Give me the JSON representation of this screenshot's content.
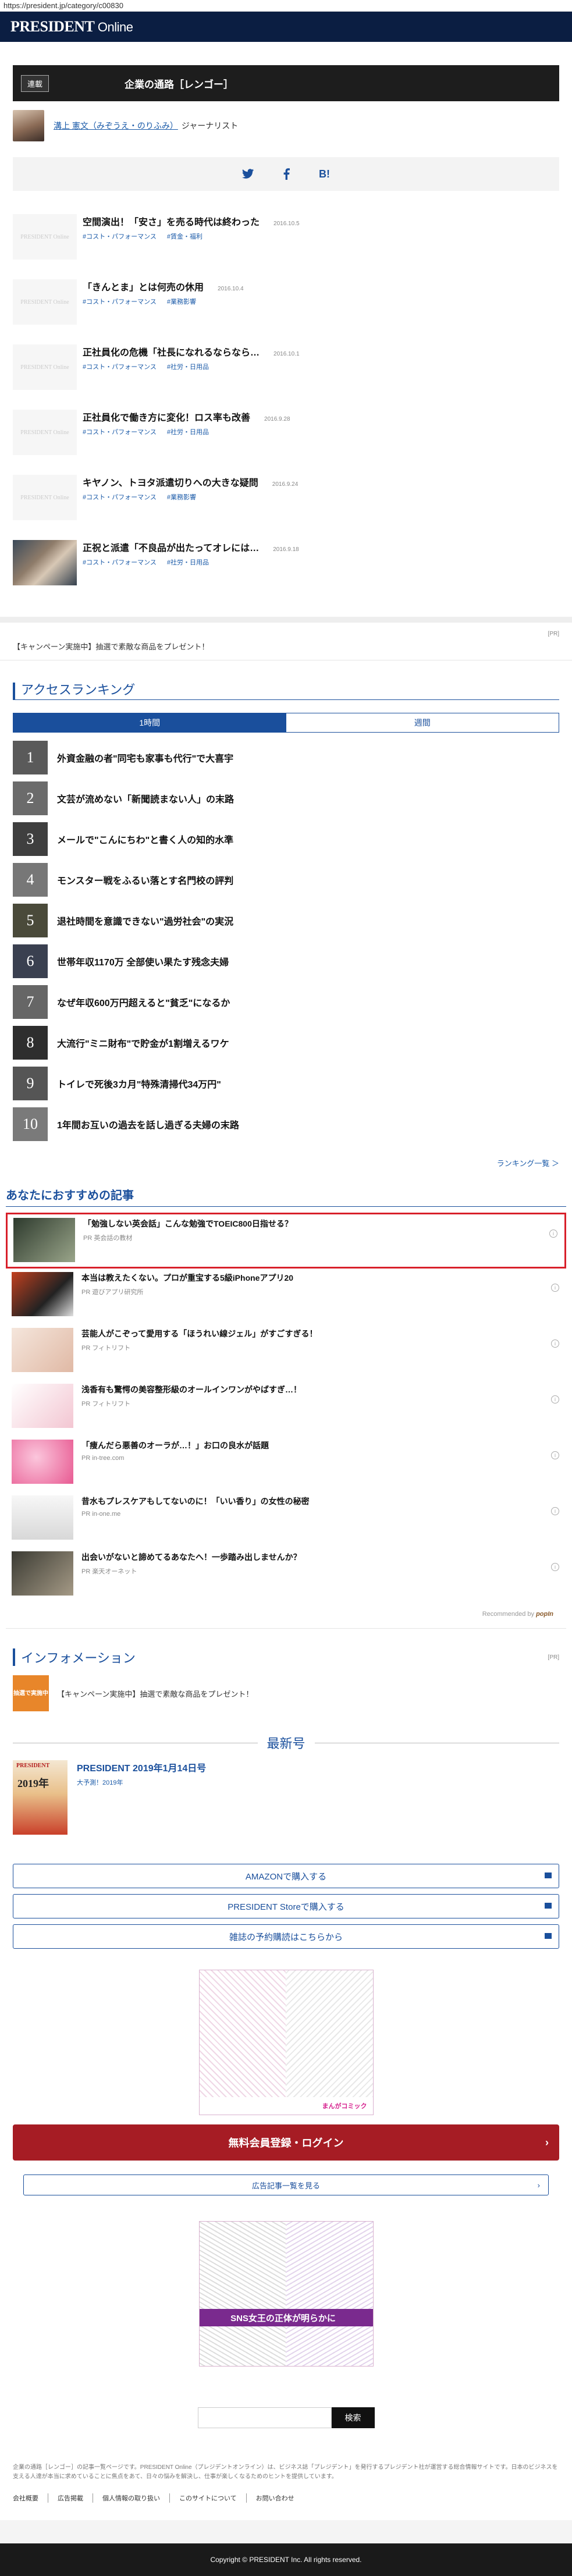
{
  "browser": {
    "url": "https://president.jp/category/c00830"
  },
  "header": {
    "logo_main": "PRESIDENT",
    "logo_sub": "Online"
  },
  "category": {
    "tag": "連載",
    "title": "企業の通路［レンゴー］"
  },
  "author": {
    "name": "溝上 憲文（みぞうえ・のりふみ）",
    "role": "ジャーナリスト"
  },
  "share": {
    "twitter": "twitter-icon",
    "facebook": "facebook-icon",
    "hatena": "B!"
  },
  "articles": [
    {
      "title": "空間演出！「安さ」を売る時代は終わった",
      "date": "2016.10.5",
      "tags": [
        "#コスト・パフォーマンス",
        "#賃金・福利"
      ],
      "thumb": "PRESIDENT Online"
    },
    {
      "title": "「きんとま」とは何売の休用",
      "date": "2016.10.4",
      "tags": [
        "#コスト・パフォーマンス",
        "#業務影響"
      ],
      "thumb": "PRESIDENT Online"
    },
    {
      "title": "正社員化の危機「社長になれるならなら…",
      "date": "2016.10.1",
      "tags": [
        "#コスト・パフォーマンス",
        "#社労・日用品"
      ],
      "thumb": "PRESIDENT Online"
    },
    {
      "title": "正社員化で働き方に変化！ロス率も改善",
      "date": "2016.9.28",
      "tags": [
        "#コスト・パフォーマンス",
        "#社労・日用品"
      ],
      "thumb": "PRESIDENT Online"
    },
    {
      "title": "キヤノン、トヨタ派遣切りへの大きな疑問",
      "date": "2016.9.24",
      "tags": [
        "#コスト・パフォーマンス",
        "#業務影響"
      ],
      "thumb": "PRESIDENT Online"
    },
    {
      "title": "正祝と派遣「不良品が出たってオレには…",
      "date": "2016.9.18",
      "tags": [
        "#コスト・パフォーマンス",
        "#社労・日用品"
      ],
      "thumb": ""
    }
  ],
  "campaign": {
    "ad_label": "[PR]",
    "text": "【キャンペーン実施中】抽選で素敵な商品をプレゼント！"
  },
  "ranking": {
    "title": "アクセスランキング",
    "tabs": [
      "1時間",
      "週間"
    ],
    "items": [
      {
        "rank": "1",
        "title": "外資金融の者\"同宅も家事も代行\"で大喜宇"
      },
      {
        "rank": "2",
        "title": "文芸が流めない「新聞読まない人」の末路"
      },
      {
        "rank": "3",
        "title": "メールで\"こんにちわ\"と書く人の知的水準"
      },
      {
        "rank": "4",
        "title": "モンスター戦をふるい落とす名門校の評判"
      },
      {
        "rank": "5",
        "title": "退社時間を意識できない\"過労社会\"の実況"
      },
      {
        "rank": "6",
        "title": "世帯年収1170万 全部使い果たす残念夫婦"
      },
      {
        "rank": "7",
        "title": "なぜ年収600万円超えると\"貧乏\"になるか"
      },
      {
        "rank": "8",
        "title": "大流行\"ミニ財布\"で貯金が1割増えるワケ"
      },
      {
        "rank": "9",
        "title": "トイレで死後3カ月\"特殊清掃代34万円\""
      },
      {
        "rank": "10",
        "title": "1年間お互いの過去を話し過ぎる夫婦の末路"
      }
    ],
    "more": "ランキング一覧 ＞"
  },
  "recommend": {
    "title": "あなたにおすすめの記事",
    "items": [
      {
        "headline": "「勉強しない英会話」こんな勉強でTOEIC800日指せる？",
        "source": "PR 英会話の教材",
        "thumb_color": "#2d3a2d"
      },
      {
        "headline": "本当は教えたくない。プロが重宝する5級iPhoneアプリ20",
        "source": "PR 遊びアプリ研究所",
        "thumb_color": "#c2401f"
      },
      {
        "headline": "芸能人がこぞって愛用する「ほうれい線ジェル」がすごすぎる！",
        "source": "PR フィトリフト",
        "thumb_color": "#e0b9a5"
      },
      {
        "headline": "浅香有も驚愕の美容整形級のオールインワンがやばすぎ…！",
        "source": "PR フィトリフト",
        "thumb_color": "#f3c6d2"
      },
      {
        "headline": "「痩んだら悪善のオーラが…！」お口の良水が話題",
        "source": "PR in-tree.com",
        "thumb_color": "#e85a92"
      },
      {
        "headline": "昔水もプレスケアもしてないのに！「いい香り」の女性の秘密",
        "source": "PR in-one.me",
        "thumb_color": "#e6e6e6"
      },
      {
        "headline": "出会いがないと諦めてるあなたへ！一歩踏み出しませんか？",
        "source": "PR 楽天オーネット",
        "thumb_color": "#6f6656"
      }
    ],
    "recommended_by": "Recommended by",
    "brand": "popIn"
  },
  "information": {
    "title": "インフォメーション",
    "ad_label": "[PR]",
    "badge": "抽選で実施中",
    "text": "【キャンペーン実施中】抽選で素敵な商品をプレゼント！"
  },
  "latest": {
    "heading": "最新号",
    "title": "PRESIDENT 2019年1月14日号",
    "subtitle": "大予測！2019年",
    "cover_logo": "PRESIDENT",
    "cover_year": "2019年",
    "buttons": [
      "AMAZONで購入する",
      "PRESIDENT Storeで購入する",
      "雑誌の予約購読はこちらから"
    ]
  },
  "ads": {
    "banner1": "まんがコミック",
    "banner2": "SNS女王の正体が明らかに"
  },
  "register": {
    "label": "無料会員登録・ログイン",
    "arrow": "›"
  },
  "adlist": {
    "label": "広告記事一覧を見る",
    "arrow": "›"
  },
  "search": {
    "placeholder": "",
    "button": "検索"
  },
  "footer": {
    "text": "企業の通路［レンゴー］の記事一覧ページです。PRESIDENT Online（プレジデントオンライン）は、ビジネス誌「プレジデント」を発行するプレジデント社が運営する総合情報サイトです。日本のビジネスを支える人達が本当に求めていることに焦点をあて、日々の悩みを解決し、仕事が楽しくなるためのヒントを提供しています。",
    "links": [
      "会社概要",
      "広告掲載",
      "個人情報の取り扱い",
      "このサイトについて",
      "お問い合わせ"
    ],
    "copyright": "Copyright © PRESIDENT Inc. All rights reserved."
  }
}
